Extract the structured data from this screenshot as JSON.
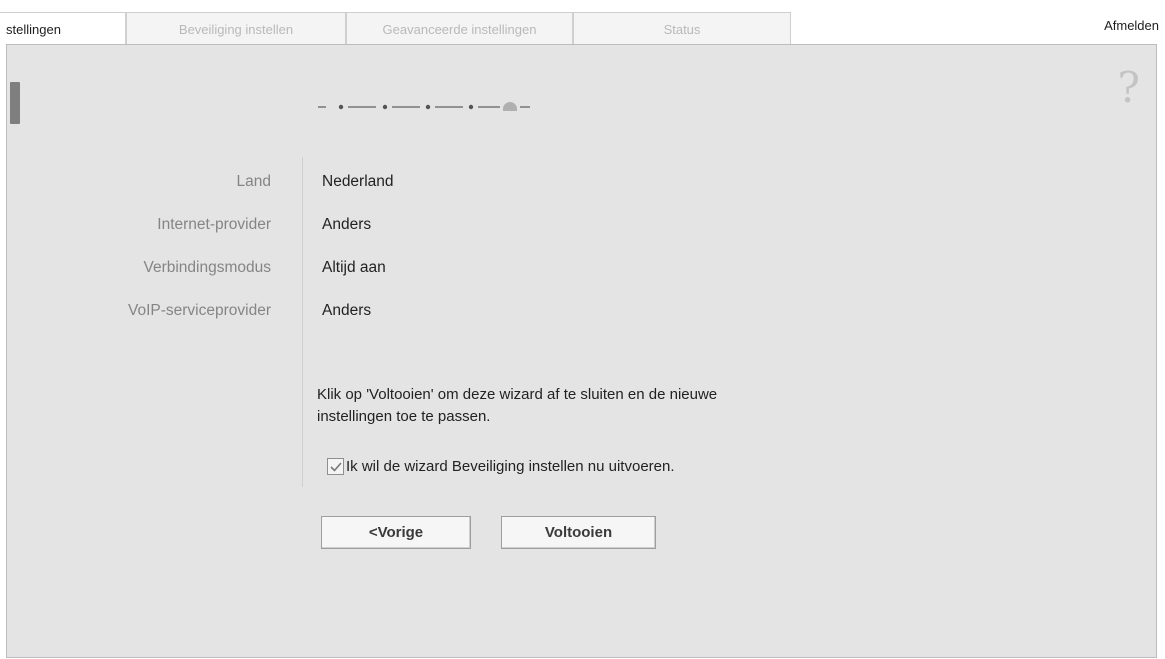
{
  "tabs": [
    {
      "label": "stellingen",
      "active": true
    },
    {
      "label": "Beveiliging instellen",
      "active": false
    },
    {
      "label": "Geavanceerde instellingen",
      "active": false
    },
    {
      "label": "Status",
      "active": false
    }
  ],
  "header": {
    "logout_label": "Afmelden"
  },
  "help": {
    "glyph": "?"
  },
  "wizard": {
    "total_steps": 5,
    "current_step": 5
  },
  "summary": [
    {
      "label": "Land",
      "value": "Nederland"
    },
    {
      "label": "Internet-provider",
      "value": "Anders"
    },
    {
      "label": "Verbindingsmodus",
      "value": "Altijd aan"
    },
    {
      "label": "VoIP-serviceprovider",
      "value": "Anders"
    }
  ],
  "message": {
    "line1": "Klik op 'Voltooien' om deze wizard af te sluiten en de nieuwe",
    "line2": "instellingen toe te passen."
  },
  "checkbox": {
    "label": "Ik wil de wizard Beveiliging instellen nu uitvoeren.",
    "checked": true
  },
  "buttons": {
    "back_label": "<Vorige",
    "finish_label": "Voltooien"
  }
}
